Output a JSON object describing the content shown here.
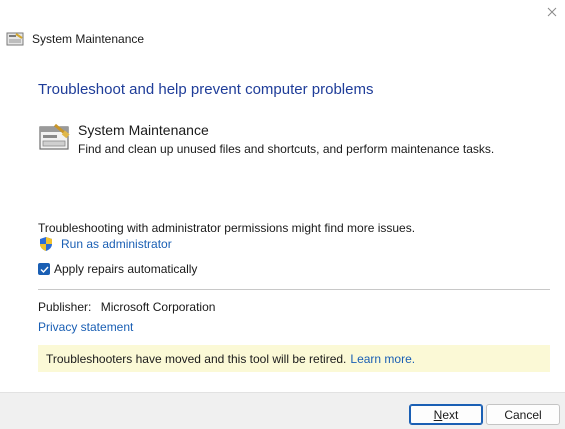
{
  "window": {
    "title": "System Maintenance",
    "close_icon": "close-icon"
  },
  "main": {
    "heading": "Troubleshoot and help prevent computer problems",
    "tool": {
      "name": "System Maintenance",
      "description": "Find and clean up unused files and shortcuts, and perform maintenance tasks.",
      "icon": "system-maintenance-icon"
    },
    "admin_notice": "Troubleshooting with administrator permissions might find more issues.",
    "run_as_admin": "Run as administrator",
    "apply_repairs": {
      "label": "Apply repairs automatically",
      "checked": true
    },
    "publisher_label": "Publisher:",
    "publisher_value": "Microsoft Corporation",
    "privacy_link": "Privacy statement",
    "retire_notice": "Troubleshooters have moved and this tool will be retired.",
    "learn_more": "Learn more."
  },
  "footer": {
    "next_label_first": "N",
    "next_label_rest": "ext",
    "cancel_label": "Cancel"
  },
  "colors": {
    "heading": "#1f3d99",
    "link": "#1a5fb4",
    "notice_bg": "#fbf9d6",
    "footer_bg": "#f0f0f0"
  }
}
